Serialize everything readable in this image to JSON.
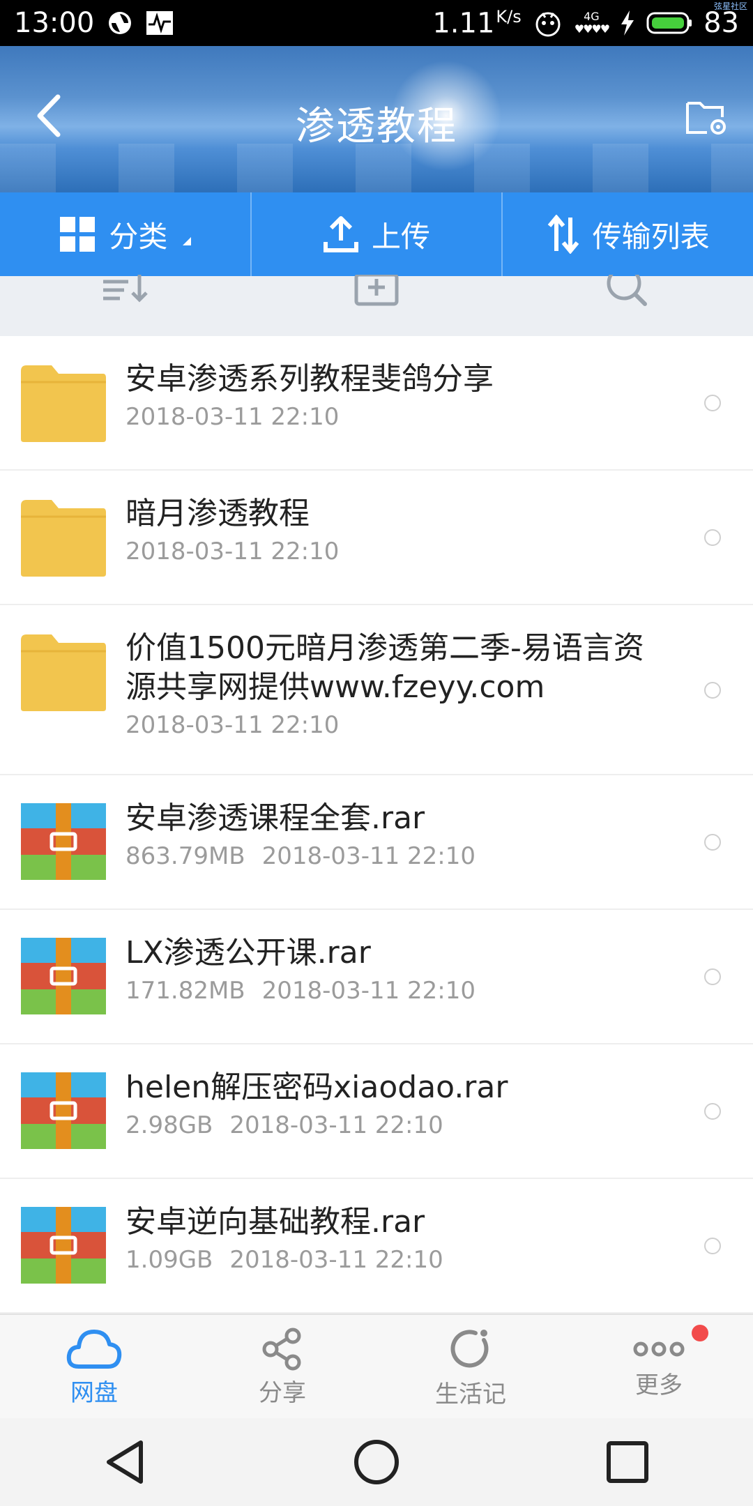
{
  "status_bar": {
    "time": "13:00",
    "net_speed": "1.11",
    "net_unit": "K/s",
    "signal_label": "4G",
    "battery": "83",
    "tiny_note": "弦星社区"
  },
  "header": {
    "title": "渗透教程"
  },
  "action_bar": {
    "category": "分类",
    "upload": "上传",
    "transfer_list": "传输列表"
  },
  "files": [
    {
      "name": "安卓渗透系列教程斐鸽分享",
      "size": "",
      "date": "2018-03-11  22:10",
      "type": "folder"
    },
    {
      "name": "暗月渗透教程",
      "size": "",
      "date": "2018-03-11  22:10",
      "type": "folder"
    },
    {
      "name": "价值1500元暗月渗透第二季-易语言资源共享网提供www.fzeyy.com",
      "size": "",
      "date": "2018-03-11  22:10",
      "type": "folder"
    },
    {
      "name": "安卓渗透课程全套.rar",
      "size": "863.79MB",
      "date": "2018-03-11  22:10",
      "type": "rar"
    },
    {
      "name": "LX渗透公开课.rar",
      "size": "171.82MB",
      "date": "2018-03-11  22:10",
      "type": "rar"
    },
    {
      "name": "helen解压密码xiaodao.rar",
      "size": "2.98GB",
      "date": "2018-03-11  22:10",
      "type": "rar"
    },
    {
      "name": "安卓逆向基础教程.rar",
      "size": "1.09GB",
      "date": "2018-03-11  22:10",
      "type": "rar"
    }
  ],
  "bottom_nav": {
    "disk": "网盘",
    "share": "分享",
    "life": "生活记",
    "more": "更多"
  },
  "colors": {
    "accent": "#2f8ff1",
    "folder": "#f2c54e",
    "rar_top": "#3fb3e6",
    "rar_mid": "#d9533a",
    "rar_bottom": "#7ac24a",
    "rar_band": "#e38e1e"
  }
}
